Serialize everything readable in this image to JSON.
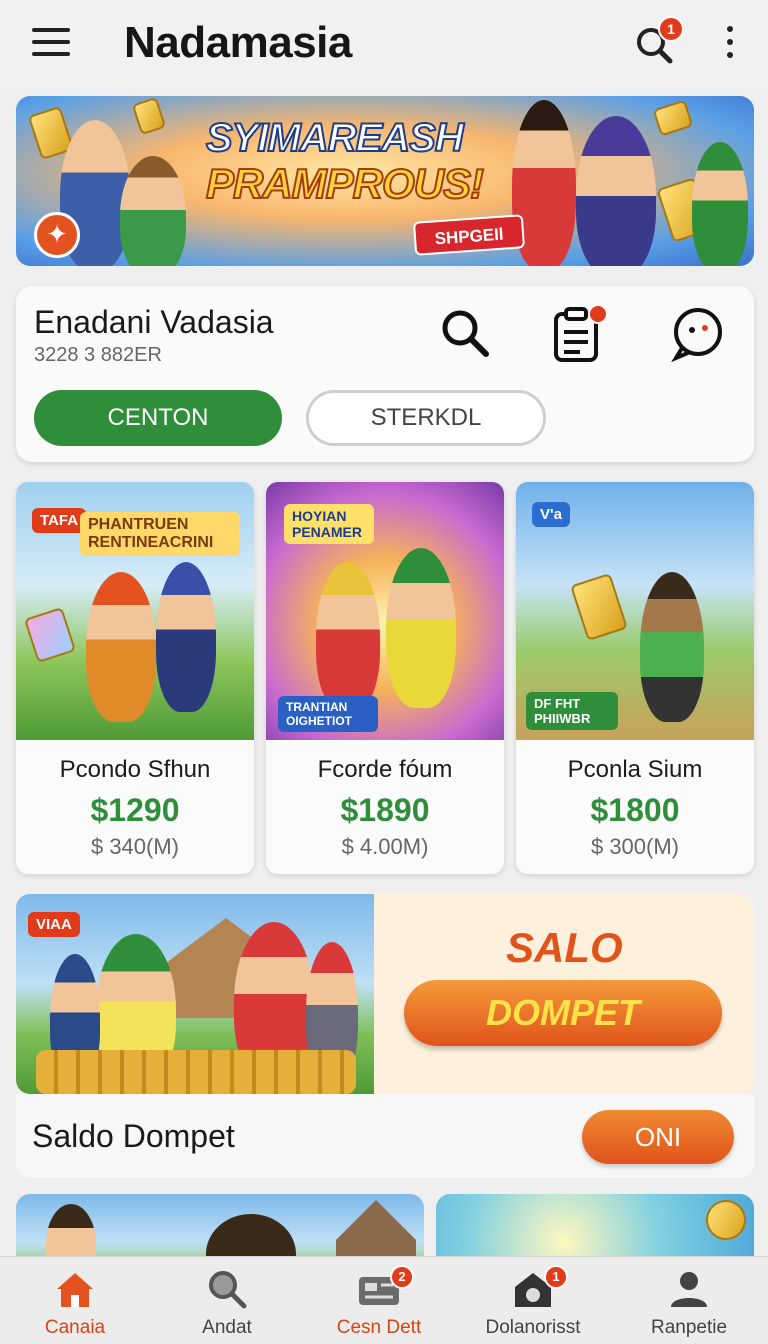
{
  "header": {
    "title": "Nadamasia",
    "search_badge": "1"
  },
  "hero": {
    "title": "SYIMAREASH",
    "subtitle": "PRAMPROUS!",
    "button_label": "SHPGEIl"
  },
  "profile": {
    "name": "Enadani Vadasia",
    "id": "3228 3 882ER",
    "primary_button": "CENTON",
    "secondary_button": "STERKDL"
  },
  "products": [
    {
      "name": "Pcondo Sfhun",
      "price": "$1290",
      "sub": "$ 340(M)",
      "tag": "TAFA",
      "art_title": "PHANTRUEN RENTINEACRINI"
    },
    {
      "name": "Fcorde fóum",
      "price": "$1890",
      "sub": "$ 4.00M)",
      "tag": "HOYIAN PENAMER",
      "art_title": "TRANTIAN OIGHETIOT"
    },
    {
      "name": "Pconla Sium",
      "price": "$1800",
      "sub": "$ 300(M)",
      "tag": "V'a",
      "art_title": "DF FHT PHIIWBR"
    }
  ],
  "promo": {
    "tag": "VIAA",
    "title": "SALO",
    "button_label": "DOMPET"
  },
  "section": {
    "title": "Saldo Dompet",
    "toggle_label": "ONI"
  },
  "bottom_nav": [
    {
      "label": "Canaia",
      "icon": "home-icon",
      "active": true
    },
    {
      "label": "Andat",
      "icon": "search-icon",
      "active": false
    },
    {
      "label": "Cesn Dett",
      "icon": "news-icon",
      "active": false,
      "badge": "2"
    },
    {
      "label": "Dolanorisst",
      "icon": "camera-house-icon",
      "active": false,
      "badge": "1"
    },
    {
      "label": "Ranpetie",
      "icon": "person-icon",
      "active": false
    }
  ],
  "colors": {
    "primary_green": "#2f8e3a",
    "accent_orange": "#e0541b",
    "badge_red": "#e23b1a"
  }
}
